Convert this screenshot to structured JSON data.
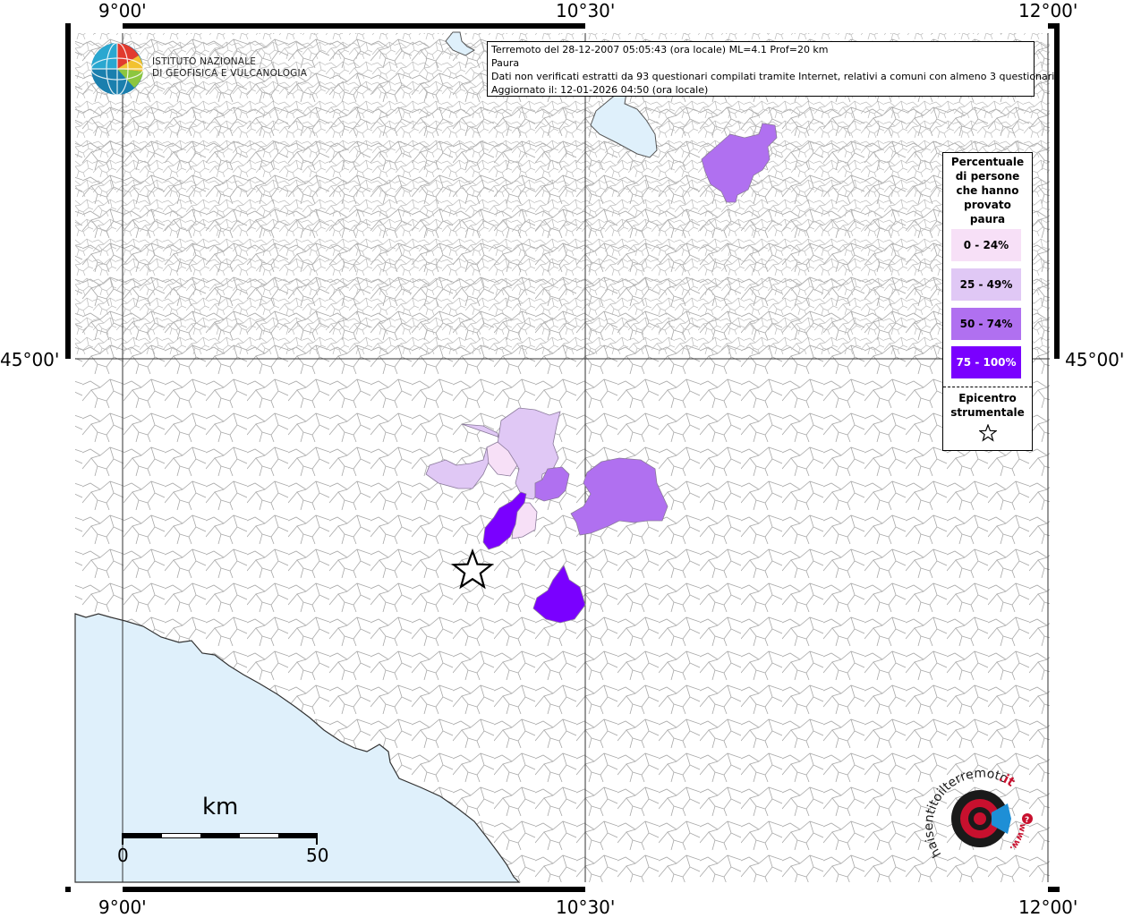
{
  "info": {
    "line1": "Terremoto del 28-12-2007 05:05:43 (ora locale) ML=4.1 Prof=20 km",
    "line2": "Paura",
    "line3": "Dati non verificati estratti da 93 questionari compilati tramite Internet, relativi a comuni con almeno 3 questionari.",
    "line4": "Aggiornato il: 12-01-2026 04:50 (ora locale)"
  },
  "ticks": {
    "top": [
      "9°00'",
      "10°30'",
      "12°00'"
    ],
    "bottom": [
      "9°00'",
      "10°30'",
      "12°00'"
    ],
    "left": "45°00'",
    "right": "45°00'"
  },
  "logo_ingv": {
    "line1": "ISTITUTO NAZIONALE",
    "line2": "DI GEOFISICA E VULCANOLOGIA"
  },
  "legend": {
    "title_lines": [
      "Percentuale",
      "di persone",
      "che hanno",
      "provato",
      "paura"
    ],
    "classes": [
      {
        "label": "0 - 24%",
        "color": "#f7e0f7",
        "text_color": "#000000"
      },
      {
        "label": "25 - 49%",
        "color": "#e0c8f5",
        "text_color": "#000000"
      },
      {
        "label": "50 - 74%",
        "color": "#b070f0",
        "text_color": "#000000"
      },
      {
        "label": "75 - 100%",
        "color": "#7a00ff",
        "text_color": "#ffffff"
      }
    ],
    "epicenter_lines": [
      "Epicentro",
      "strumentale"
    ]
  },
  "scalebar": {
    "unit": "km",
    "start": "0",
    "end": "50"
  },
  "logo_hsit": {
    "text_main": "haisentitoilterremoto",
    "text_tld": ".it",
    "text_www": "www."
  },
  "colors": {
    "sea": "#dff0fb",
    "border_lines": "#9a9a9a",
    "frame": "#000000"
  }
}
